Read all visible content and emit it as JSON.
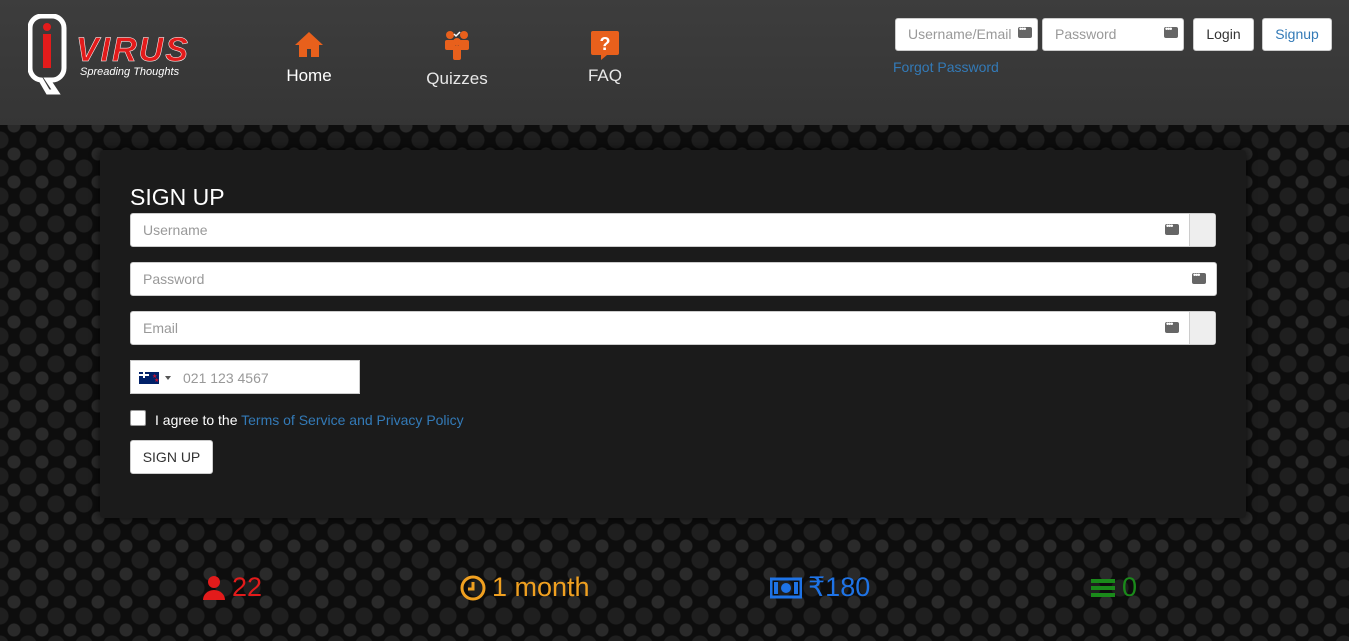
{
  "brand": {
    "logo_text": "VIRUS",
    "tagline": "Spreading Thoughts",
    "logo_letters": "iQ"
  },
  "nav": [
    {
      "label": "Home",
      "icon": "home-icon"
    },
    {
      "label": "Quizzes",
      "icon": "quiz-group-icon"
    },
    {
      "label": "FAQ",
      "icon": "question-icon"
    }
  ],
  "login": {
    "username_placeholder": "Username/Email",
    "password_placeholder": "Password",
    "login_label": "Login",
    "signup_label": "Signup",
    "forgot_label": "Forgot Password"
  },
  "signup": {
    "title": "SIGN UP",
    "username_placeholder": "Username",
    "password_placeholder": "Password",
    "email_placeholder": "Email",
    "phone_placeholder": "021 123 4567",
    "agree_text": "I agree to the ",
    "terms_link": "Terms of Service and Privacy Policy",
    "submit_label": "SIGN UP"
  },
  "stats": [
    {
      "icon": "user-icon",
      "value": "22",
      "color": "#e31b1b"
    },
    {
      "icon": "clock-icon",
      "value": "1 month",
      "color": "#f0a020"
    },
    {
      "icon": "money-icon",
      "value": "₹180",
      "color": "#1e73e6"
    },
    {
      "icon": "list-icon",
      "value": "0",
      "color": "#1a8a1a"
    }
  ],
  "colors": {
    "accent_orange": "#e8601c",
    "link": "#337ab7",
    "brand_red": "#e31b1b"
  }
}
